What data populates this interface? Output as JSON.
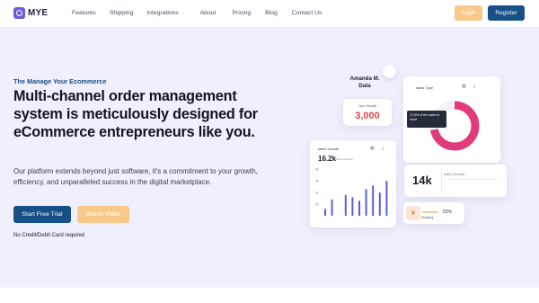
{
  "brand": {
    "logo_text": "MYE",
    "logo_icon": "logo-icon"
  },
  "nav": {
    "links": [
      "Features",
      "Shipping",
      "Integrations",
      "About",
      "Pricing",
      "Blog",
      "Contact Us"
    ],
    "login_label": "Login",
    "register_label": "Register"
  },
  "hero": {
    "eyebrow": "The Manage Your Ecommerce",
    "headline": "Multi-channel order management system is meticulously designed for eCommerce entrepreneurs like you.",
    "description": "Our platform extends beyond just software, it's a commitment to your growth, efficiency, and unparalleled success in the digital marketplace.",
    "primary_cta": "Start Free Trial",
    "secondary_cta": "Watch Video",
    "note": "No Credit/Debit Card required"
  },
  "dashboard": {
    "user_name": "Amanda M. Data",
    "growth_label": "Your Growth",
    "growth_value": "3,000",
    "donut_title": "sales Type",
    "donut_fraction": 0.72,
    "tooltip_text": "72.5% of the sales is short",
    "bar_title": "sales Growth",
    "bar_value": "16.2k",
    "bar_sub": "New customer",
    "bar_y_ticks": [
      "5k",
      "4k",
      "3k",
      "2k"
    ],
    "bar_values": [
      1.6,
      2.4,
      1.0,
      2.8,
      2.6,
      2.3,
      3.3,
      3.6,
      3.0,
      4.0
    ],
    "stat_value": "14k",
    "stat_label": "sales Growth",
    "ship_label": "Shipping",
    "ship_percent": "52%",
    "colors": {
      "accent_pink": "#e23b7c",
      "bar_purple": "#5b5fd6",
      "navy": "#174f87",
      "orange": "#f9c98a"
    }
  }
}
